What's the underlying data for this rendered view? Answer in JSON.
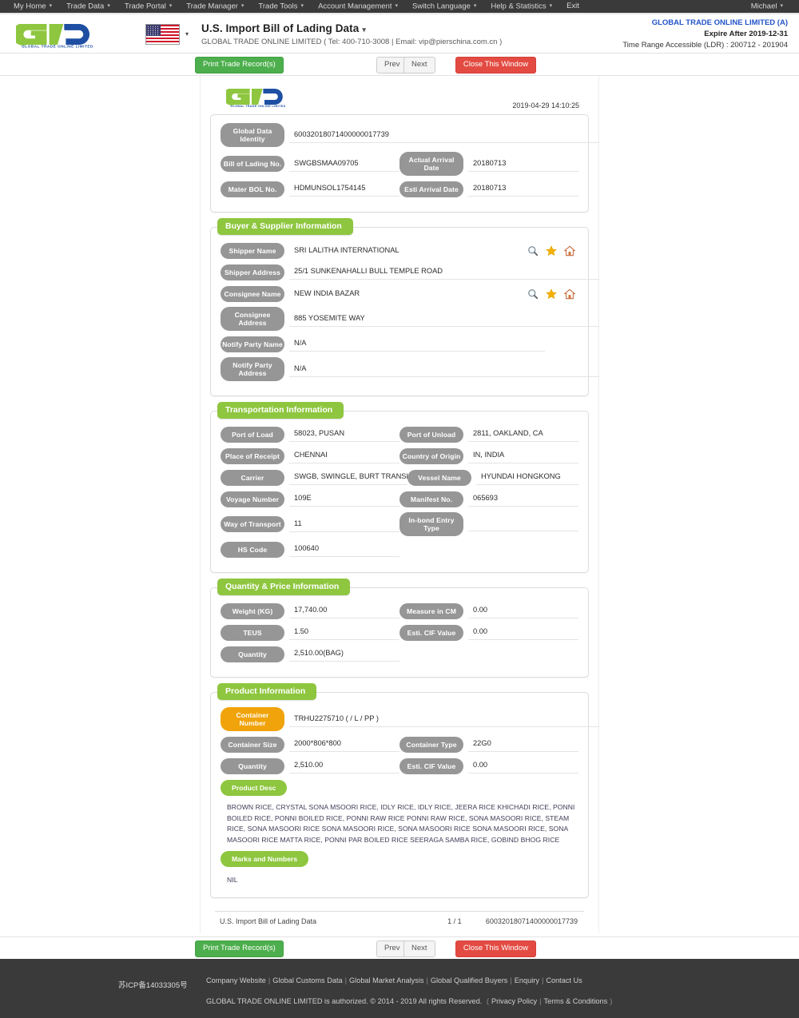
{
  "topnav": {
    "items": [
      {
        "label": "My Home",
        "caret": true
      },
      {
        "label": "Trade Data",
        "caret": true
      },
      {
        "label": "Trade Portal",
        "caret": true
      },
      {
        "label": "Trade Manager",
        "caret": true
      },
      {
        "label": "Trade Tools",
        "caret": true
      },
      {
        "label": "Account Management",
        "caret": true
      },
      {
        "label": "Switch Language",
        "caret": true
      },
      {
        "label": "Help & Statistics",
        "caret": true
      },
      {
        "label": "Exit",
        "caret": false
      }
    ],
    "user": "Michael"
  },
  "header": {
    "logo_text": "GLOBAL TRADE ONLINE LIMITED",
    "flag": "us-flag-icon",
    "page_title": "U.S. Import Bill of Lading Data",
    "subtitle": "GLOBAL TRADE ONLINE LIMITED ( Tel: 400-710-3008 | Email: vip@pierschina.com.cn )",
    "account_name": "GLOBAL TRADE ONLINE LIMITED (A)",
    "expire": "Expire After 2019-12-31",
    "time_range": "Time Range Accessible (LDR) : 200712 - 201904"
  },
  "toolbar": {
    "print_label": "Print Trade Record(s)",
    "prev_label": "Prev",
    "next_label": "Next",
    "close_label": "Close This Window"
  },
  "document": {
    "timestamp": "2019-04-29 14:10:25",
    "identity": {
      "rows": [
        {
          "label": "Global Data Identity",
          "value": "60032018071400000017739"
        },
        {
          "label": "Bill of Lading No.",
          "value": "SWGBSMAA09705",
          "label2": "Actual Arrival Date",
          "value2": "20180713"
        },
        {
          "label": "Mater BOL No.",
          "value": "HDMUNSOL1754145",
          "label2": "Esti Arrival Date",
          "value2": "20180713"
        }
      ]
    },
    "buyer_supplier": {
      "title": "Buyer & Supplier Information",
      "rows": [
        {
          "label": "Shipper Name",
          "value": "SRI LALITHA INTERNATIONAL",
          "icons": true
        },
        {
          "label": "Shipper Address",
          "value": "25/1 SUNKENAHALLI BULL TEMPLE ROAD",
          "icons": false
        },
        {
          "label": "Consignee Name",
          "value": "NEW INDIA BAZAR",
          "icons": true
        },
        {
          "label": "Consignee Address",
          "value": "885 YOSEMITE WAY",
          "icons": false
        },
        {
          "label": "Notify Party Name",
          "value": "N/A",
          "icons": false
        },
        {
          "label": "Notify Party Address",
          "value": "N/A",
          "icons": false
        }
      ]
    },
    "transportation": {
      "title": "Transportation Information",
      "rows": [
        {
          "label": "Port of Load",
          "value": "58023, PUSAN",
          "label2": "Port of Unload",
          "value2": "2811, OAKLAND, CA"
        },
        {
          "label": "Place of Receipt",
          "value": "CHENNAI",
          "label2": "Country of Origin",
          "value2": "IN, INDIA"
        },
        {
          "label": "Carrier",
          "value": "SWGB, SWINGLE, BURT TRANSPORT",
          "label2": "Vessel Name",
          "value2": "HYUNDAI HONGKONG"
        },
        {
          "label": "Voyage Number",
          "value": "109E",
          "label2": "Manifest No.",
          "value2": "065693"
        },
        {
          "label": "Way of Transport",
          "value": "11",
          "label2": "In-bond Entry Type",
          "value2": ""
        },
        {
          "label": "HS Code",
          "value": "100640"
        }
      ]
    },
    "quantity_price": {
      "title": "Quantity & Price Information",
      "rows": [
        {
          "label": "Weight (KG)",
          "value": "17,740.00",
          "label2": "Measure in CM",
          "value2": "0.00"
        },
        {
          "label": "TEUS",
          "value": "1.50",
          "label2": "Esti. CIF Value",
          "value2": "0.00"
        },
        {
          "label": "Quantity",
          "value": "2,510.00(BAG)"
        }
      ]
    },
    "product": {
      "title": "Product Information",
      "rows": [
        {
          "label": "Container Number",
          "value": "TRHU2275710 ( / L / PP )",
          "accent": "orange"
        },
        {
          "label": "Container Size",
          "value": "2000*806*800",
          "label2": "Container Type",
          "value2": "22G0"
        },
        {
          "label": "Quantity",
          "value": "2,510.00",
          "label2": "Esti. CIF Value",
          "value2": "0.00"
        }
      ],
      "product_desc_label": "Product Desc",
      "product_desc": "BROWN RICE, CRYSTAL SONA MSOORI RICE, IDLY RICE, IDLY RICE, JEERA RICE KHICHADI RICE, PONNI BOILED RICE, PONNI BOILED RICE, PONNI RAW RICE PONNI RAW RICE, SONA MASOORI RICE, STEAM RICE, SONA MASOORI RICE SONA MASOORI RICE, SONA MASOORI RICE SONA MASOORI RICE, SONA MASOORI RICE MATTA RICE, PONNI PAR BOILED RICE SEERAGA SAMBA RICE, GOBIND BHOG RICE",
      "marks_label": "Marks and Numbers",
      "marks_value": "NIL"
    },
    "footer": {
      "left": "U.S. Import Bill of Lading Data",
      "page": "1 / 1",
      "right": "60032018071400000017739"
    }
  },
  "sitefooter": {
    "icp": "苏ICP备14033305号",
    "links": [
      "Company Website",
      "Global Customs Data",
      "Global Market Analysis",
      "Global Qualified Buyers",
      "Enquiry",
      "Contact Us"
    ],
    "copyright": "GLOBAL TRADE ONLINE LIMITED is authorized. © 2014 - 2019 All rights Reserved.",
    "legal_open": "(",
    "privacy": "Privacy Policy",
    "terms": "Terms & Conditions",
    "legal_close": ")"
  }
}
